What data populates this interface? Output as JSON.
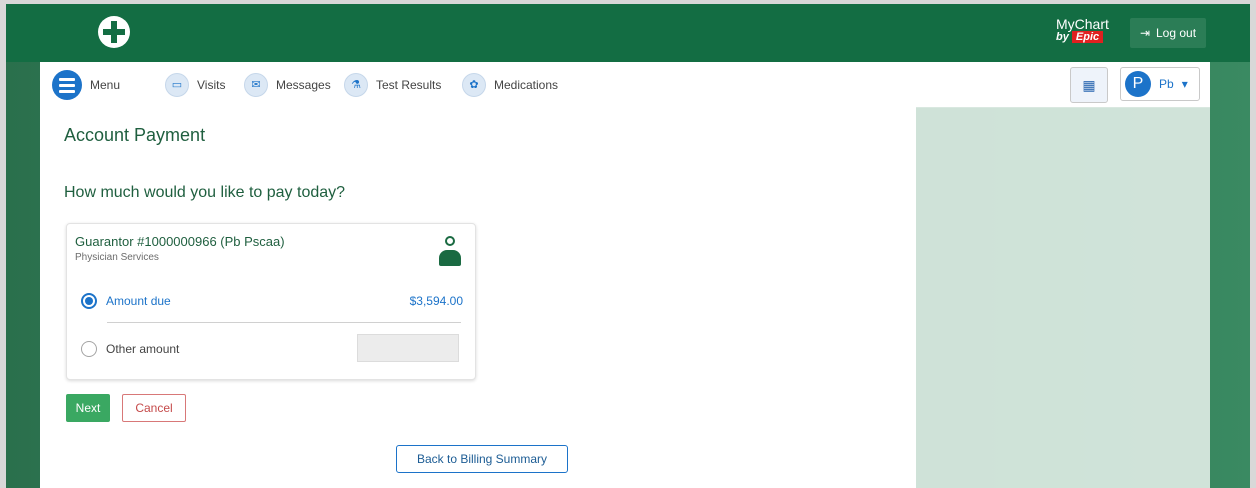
{
  "header": {
    "org_name": "",
    "brand": {
      "mychart": "MyChart",
      "by": "by",
      "epic": "Epic"
    },
    "logout_label": "Log out"
  },
  "nav": {
    "items": [
      {
        "label": "Menu",
        "icon": "menu-icon"
      },
      {
        "label": "Visits",
        "icon": "calendar-icon"
      },
      {
        "label": "Messages",
        "icon": "envelope-icon"
      },
      {
        "label": "Test Results",
        "icon": "flask-icon"
      },
      {
        "label": "Medications",
        "icon": "pills-icon"
      }
    ],
    "user_initial": "P",
    "user_name": "Pb"
  },
  "page": {
    "title": "Account Payment",
    "question": "How much would you like to pay today?",
    "account": {
      "title": "Guarantor #1000000966 (Pb Pscaa)",
      "subtitle": "Physician Services"
    },
    "options": [
      {
        "label": "Amount due",
        "value": "$3,594.00",
        "selected": true
      },
      {
        "label": "Other amount",
        "value": "",
        "selected": false
      }
    ],
    "buttons": {
      "next": "Next",
      "cancel": "Cancel",
      "back": "Back to Billing Summary"
    }
  },
  "colors": {
    "header_green": "#136d43",
    "link_blue": "#1c73c9",
    "next_green": "#3aa862",
    "cancel_red": "#c54a4a"
  }
}
